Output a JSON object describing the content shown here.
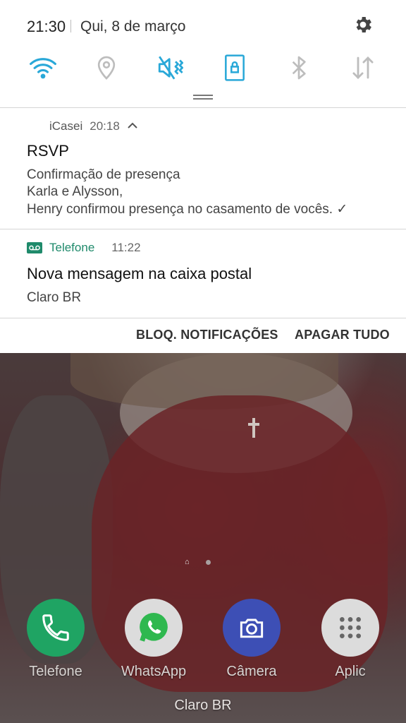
{
  "status_bar": {
    "time": "21:30",
    "date": "Qui, 8 de março"
  },
  "quick_settings": [
    {
      "name": "wifi-icon",
      "active": true
    },
    {
      "name": "location-icon",
      "active": false
    },
    {
      "name": "sound-vibrate-icon",
      "active": true
    },
    {
      "name": "rotation-lock-icon",
      "active": true
    },
    {
      "name": "bluetooth-icon",
      "active": false
    },
    {
      "name": "mobile-data-icon",
      "active": false
    }
  ],
  "notifications": [
    {
      "app": "iCasei",
      "time": "20:18",
      "title": "RSVP",
      "lines": [
        "Confirmação de presença",
        "Karla e Alysson,",
        "Henry confirmou presença no casamento de vocês. ✓"
      ]
    },
    {
      "app": "Telefone",
      "time": "11:22",
      "title": "Nova mensagem na caixa postal",
      "lines": [
        "Claro BR"
      ]
    }
  ],
  "actions": {
    "block": "BLOQ. NOTIFICAÇÕES",
    "clear": "APAGAR TUDO"
  },
  "dock": [
    {
      "label": "Telefone",
      "icon": "phone-icon"
    },
    {
      "label": "WhatsApp",
      "icon": "whatsapp-icon"
    },
    {
      "label": "Câmera",
      "icon": "camera-icon"
    },
    {
      "label": "Aplic",
      "icon": "apps-icon"
    }
  ],
  "carrier": "Claro BR",
  "colors": {
    "accent": "#29a8d8",
    "inactive": "#bdbdbd",
    "telefone_green": "#1f8a6b",
    "phone_app": "#1fa463",
    "camera_app": "#3d4fb5"
  }
}
